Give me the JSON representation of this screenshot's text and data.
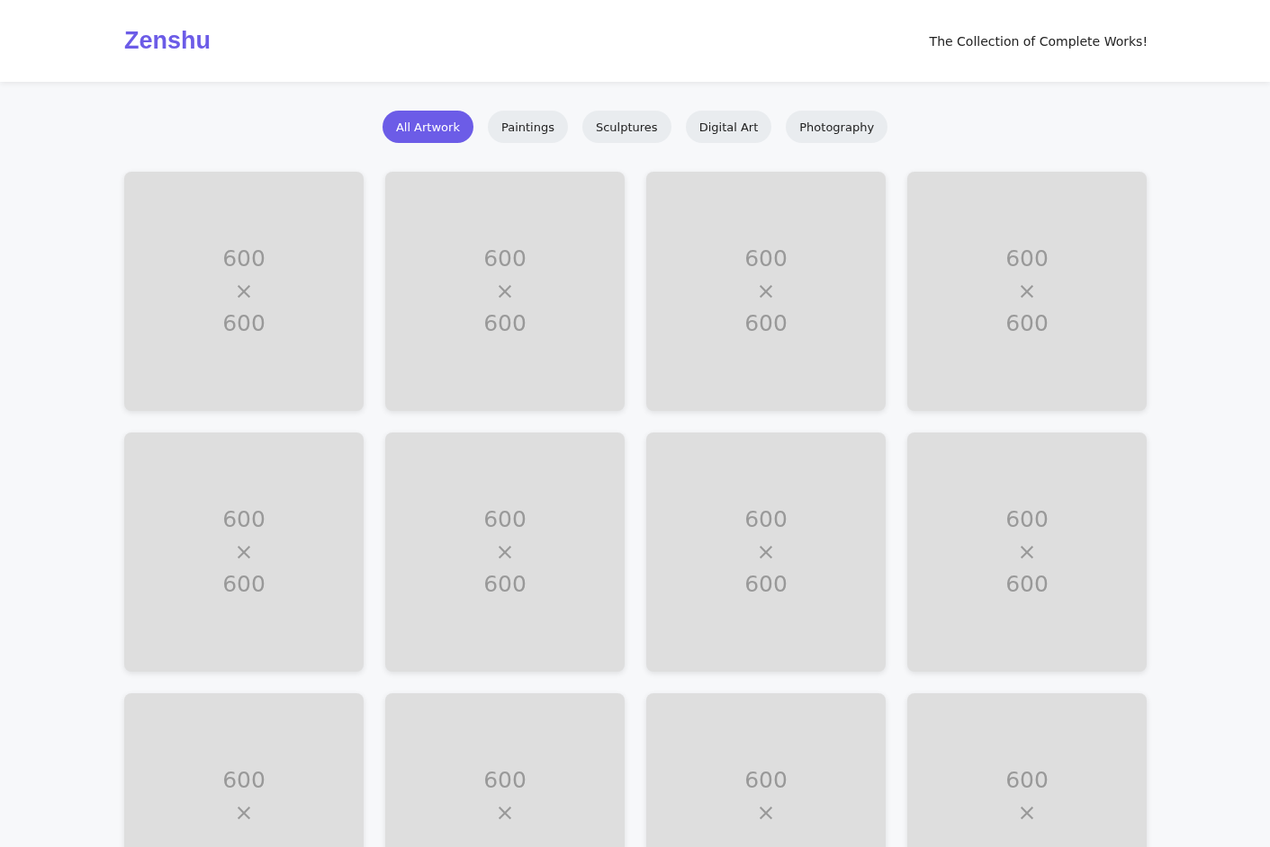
{
  "header": {
    "logo": "Zenshu",
    "tagline": "The Collection of Complete Works!"
  },
  "filters": [
    {
      "label": "All Artwork",
      "selected": true
    },
    {
      "label": "Paintings",
      "selected": false
    },
    {
      "label": "Sculptures",
      "selected": false
    },
    {
      "label": "Digital Art",
      "selected": false
    },
    {
      "label": "Photography",
      "selected": false
    }
  ],
  "gallery": [
    {
      "lines": [
        "600",
        "×",
        "600"
      ]
    },
    {
      "lines": [
        "600",
        "×",
        "600"
      ]
    },
    {
      "lines": [
        "600",
        "×",
        "600"
      ]
    },
    {
      "lines": [
        "600",
        "×",
        "600"
      ]
    },
    {
      "lines": [
        "600",
        "×",
        "600"
      ]
    },
    {
      "lines": [
        "600",
        "×",
        "600"
      ]
    },
    {
      "lines": [
        "600",
        "×",
        "600"
      ]
    },
    {
      "lines": [
        "600",
        "×",
        "600"
      ]
    },
    {
      "lines": [
        "600",
        "×"
      ]
    },
    {
      "lines": [
        "600",
        "×"
      ]
    },
    {
      "lines": [
        "600",
        "×"
      ]
    },
    {
      "lines": [
        "600",
        "×"
      ]
    }
  ]
}
